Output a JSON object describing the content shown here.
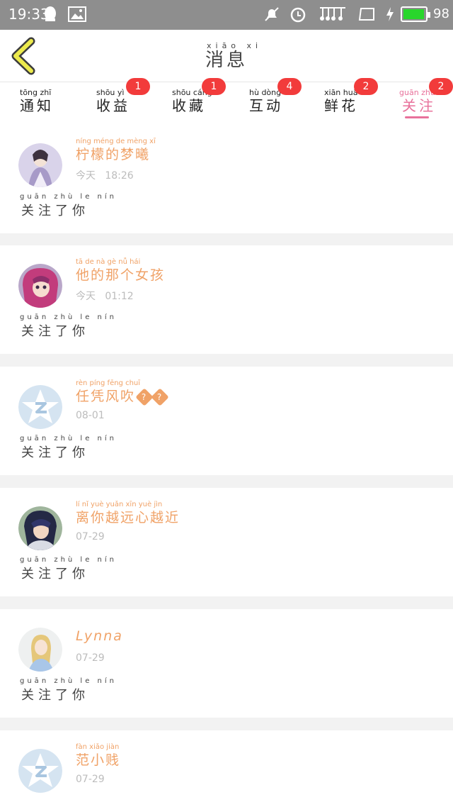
{
  "status_bar": {
    "time": "19:33",
    "battery": "98",
    "battery_level": 0.98
  },
  "header": {
    "title": "消息",
    "title_pinyin": "xiāo xi"
  },
  "tabs": [
    {
      "label": "通知",
      "pinyin": "tōng zhī",
      "badge": ""
    },
    {
      "label": "收益",
      "pinyin": "shōu yì",
      "badge": "1"
    },
    {
      "label": "收藏",
      "pinyin": "shōu cáng",
      "badge": "1"
    },
    {
      "label": "互动",
      "pinyin": "hù dòng",
      "badge": "4"
    },
    {
      "label": "鲜花",
      "pinyin": "xiān huā",
      "badge": "2"
    },
    {
      "label": "关注",
      "pinyin": "guān zhù",
      "badge": "2",
      "active": true
    }
  ],
  "messages": [
    {
      "name": "柠檬的梦曦",
      "name_pinyin": "níng méng de mèng xī",
      "date": "18:26",
      "date_prefix": "今天",
      "date_prefix_pinyin": "jīn tiān",
      "text": "关注了你",
      "text_pinyin": "guān zhù le nín",
      "avatar": "anime-girl-purple"
    },
    {
      "name": "他的那个女孩",
      "name_pinyin": "tā de nà gè nǚ hái",
      "date": "01:12",
      "date_prefix": "今天",
      "date_prefix_pinyin": "jīn tiān",
      "text": "关注了你",
      "text_pinyin": "guān zhù le nín",
      "avatar": "anime-girl-pink"
    },
    {
      "name": "任凭风吹",
      "name_pinyin": "rèn píng fēng chuī",
      "date": "08-01",
      "date_prefix": "",
      "date_prefix_pinyin": "",
      "text": "关注了你",
      "text_pinyin": "guān zhù le nín",
      "avatar": "default-z-avatar",
      "name_suffix": "??"
    },
    {
      "name": "离你越远心越近",
      "name_pinyin": "lí nǐ yuè yuǎn xīn yuè jìn",
      "date": "07-29",
      "date_prefix": "",
      "date_prefix_pinyin": "",
      "text": "关注了你",
      "text_pinyin": "guān zhù le nín",
      "avatar": "anime-boy"
    },
    {
      "name": "Lynna",
      "name_pinyin": "",
      "date": "07-29",
      "date_prefix": "",
      "date_prefix_pinyin": "",
      "text": "关注了你",
      "text_pinyin": "guān zhù le nín",
      "avatar": "anime-girl-blonde"
    },
    {
      "name": "范小贱",
      "name_pinyin": "fàn xiǎo jiàn",
      "date": "07-29",
      "date_prefix": "",
      "date_prefix_pinyin": "",
      "text": "",
      "text_pinyin": "",
      "avatar": "default-z-avatar"
    }
  ],
  "colors": {
    "accent": "#e8719b",
    "name": "#f0a267",
    "badge": "#f23b3b",
    "status_bar": "#8e8e8e"
  }
}
